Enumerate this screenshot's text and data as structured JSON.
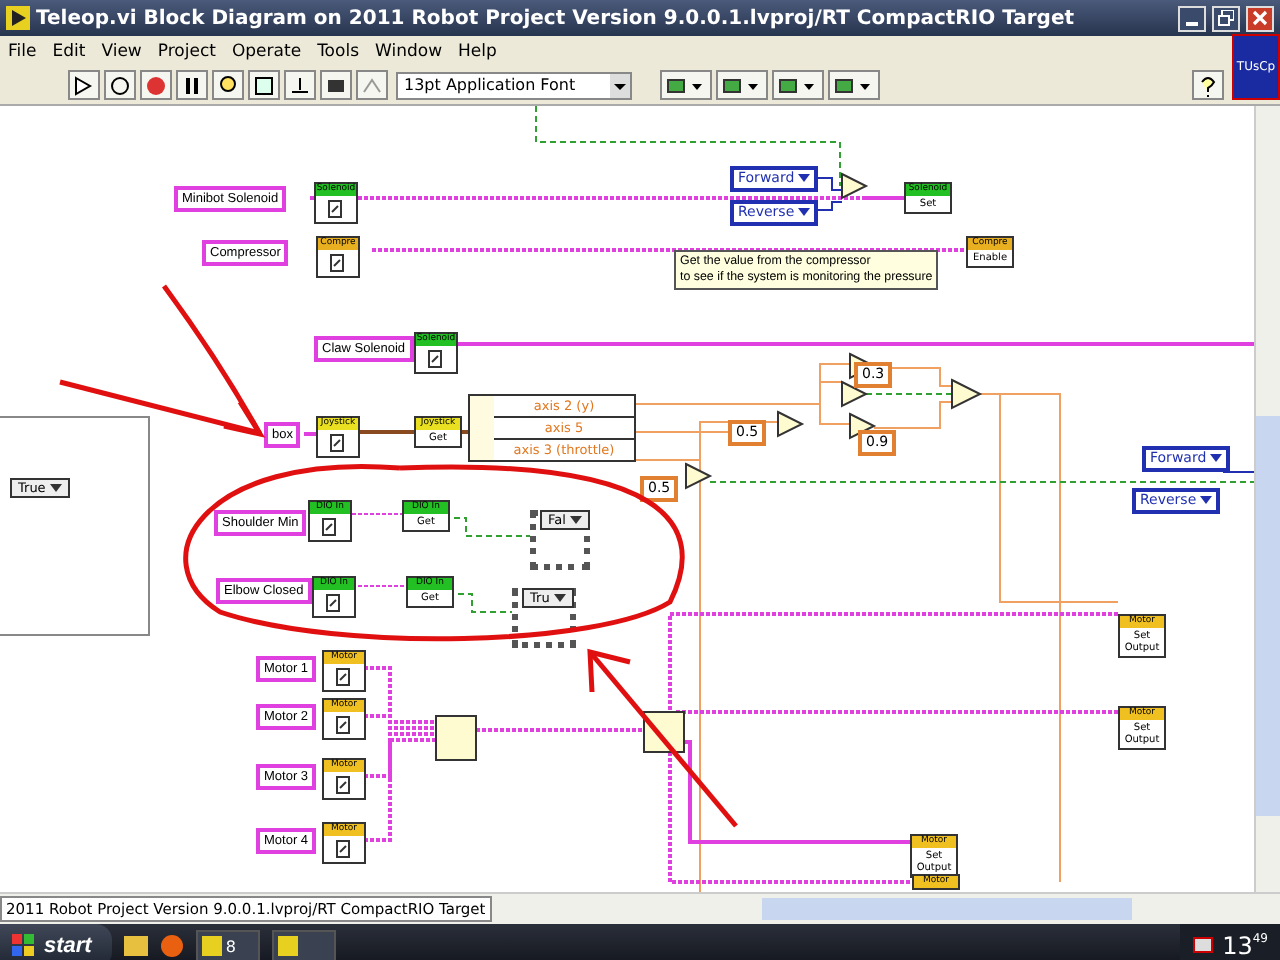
{
  "window": {
    "title": "Teleop.vi Block Diagram on 2011 Robot Project Version 9.0.0.1.lvproj/RT CompactRIO Target"
  },
  "menu": [
    "File",
    "Edit",
    "View",
    "Project",
    "Operate",
    "Tools",
    "Window",
    "Help"
  ],
  "toolbar": {
    "font": "13pt Application Font",
    "logo": "TUsCp"
  },
  "diagram": {
    "controls": [
      "Minibot Solenoid",
      "Compressor",
      "Claw Solenoid",
      "box",
      "Shoulder Min",
      "Elbow Closed",
      "Motor 1",
      "Motor 2",
      "Motor 3",
      "Motor 4"
    ],
    "refnums": [
      {
        "header": "Solenoid",
        "kind": "solenoid"
      },
      {
        "header": "Compre",
        "kind": "compressor"
      },
      {
        "header": "Solenoid",
        "kind": "solenoid"
      },
      {
        "header": "Joystick",
        "kind": "joystick"
      },
      {
        "header": "DIO In",
        "kind": "dio"
      },
      {
        "header": "DIO In",
        "kind": "dio"
      },
      {
        "header": "Motor",
        "kind": "motor"
      },
      {
        "header": "Motor",
        "kind": "motor"
      },
      {
        "header": "Motor",
        "kind": "motor"
      },
      {
        "header": "Motor",
        "kind": "motor"
      }
    ],
    "methods": [
      {
        "header": "Solenoid",
        "method": "Set",
        "kind": "solenoid"
      },
      {
        "header": "Compre",
        "method": "Enable",
        "kind": "compressor"
      },
      {
        "header": "Joystick",
        "method": "Get",
        "kind": "joystick"
      },
      {
        "header": "DIO In",
        "method": "Get",
        "kind": "dio"
      },
      {
        "header": "DIO In",
        "method": "Get",
        "kind": "dio"
      },
      {
        "header": "Motor",
        "method": "Set Output",
        "kind": "motor"
      },
      {
        "header": "Motor",
        "method": "Set Output",
        "kind": "motor"
      },
      {
        "header": "Motor",
        "method": "Set Output",
        "kind": "motor"
      },
      {
        "header": "Motor",
        "kind": "motor"
      }
    ],
    "enums": [
      "Forward",
      "Reverse",
      "Forward",
      "Reverse"
    ],
    "constants": [
      "0.3",
      "0.9",
      "0.5",
      "0.5"
    ],
    "unbundle": [
      "axis 2 (y)",
      "axis 5",
      "axis 3 (throttle)"
    ],
    "comment": [
      "Get the value from the compressor",
      "to see if the system is monitoring the pressure"
    ],
    "case_selectors": [
      "True",
      "Fal",
      "Tru"
    ]
  },
  "status_bar": "2011 Robot Project Version 9.0.0.1.lvproj/RT CompactRIO Target",
  "taskbar": {
    "start": "start",
    "group_count": "8",
    "clock_hour": "13",
    "clock_minute": "49"
  }
}
